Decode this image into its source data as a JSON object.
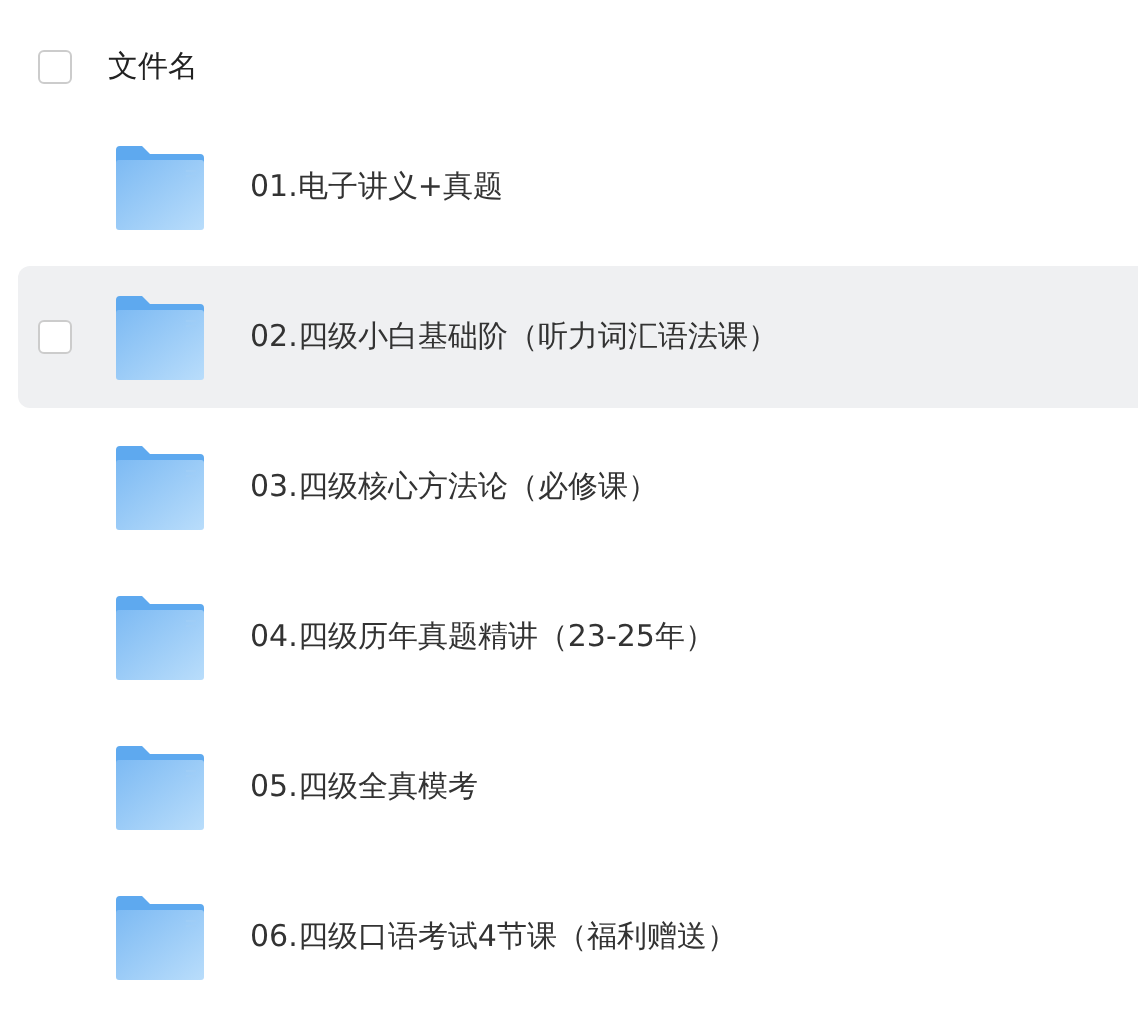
{
  "header": {
    "checked": false,
    "label": "文件名"
  },
  "files": [
    {
      "name": "01.电子讲义+真题",
      "hovered": false,
      "checked": false
    },
    {
      "name": "02.四级小白基础阶（听力词汇语法课）",
      "hovered": true,
      "checked": false
    },
    {
      "name": "03.四级核心方法论（必修课）",
      "hovered": false,
      "checked": false
    },
    {
      "name": "04.四级历年真题精讲（23-25年）",
      "hovered": false,
      "checked": false
    },
    {
      "name": "05.四级全真模考",
      "hovered": false,
      "checked": false
    },
    {
      "name": "06.四级口语考试4节课（福利赠送）",
      "hovered": false,
      "checked": false
    }
  ]
}
